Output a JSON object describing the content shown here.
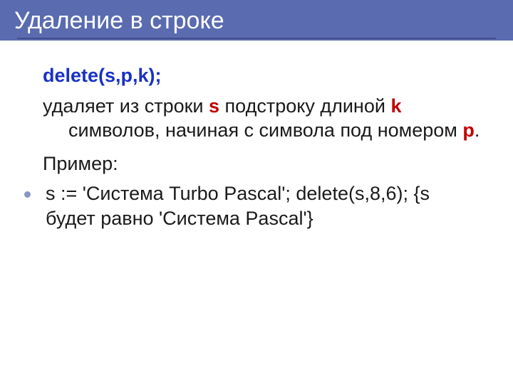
{
  "title": "Удаление в строке",
  "signature": "delete(s,p,k);",
  "desc": {
    "p1": "удаляет из строки ",
    "s": "s",
    "p2": " подстроку длиной ",
    "k": "k",
    "p3": " символов, начиная с символа под номером ",
    "p": "p",
    "p4": "."
  },
  "example_label": "Пример:",
  "example_item": "s := 'Система Turbo Pascal'; delete(s,8,6); {s будет равно 'Система Pascal'}"
}
